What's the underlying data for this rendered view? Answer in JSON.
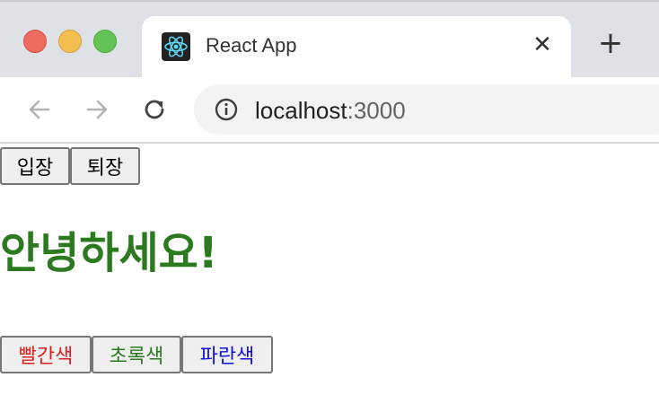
{
  "browser": {
    "tab_title": "React App",
    "url_host": "localhost",
    "url_port": ":3000"
  },
  "app": {
    "enter_label": "입장",
    "exit_label": "퇴장",
    "greeting": "안녕하세요!",
    "greeting_color": "#2c7a1f",
    "color_buttons": [
      {
        "label": "빨간색",
        "color": "#e02020"
      },
      {
        "label": "초록색",
        "color": "#2c7a1f"
      },
      {
        "label": "파란색",
        "color": "#1010e0"
      }
    ]
  }
}
